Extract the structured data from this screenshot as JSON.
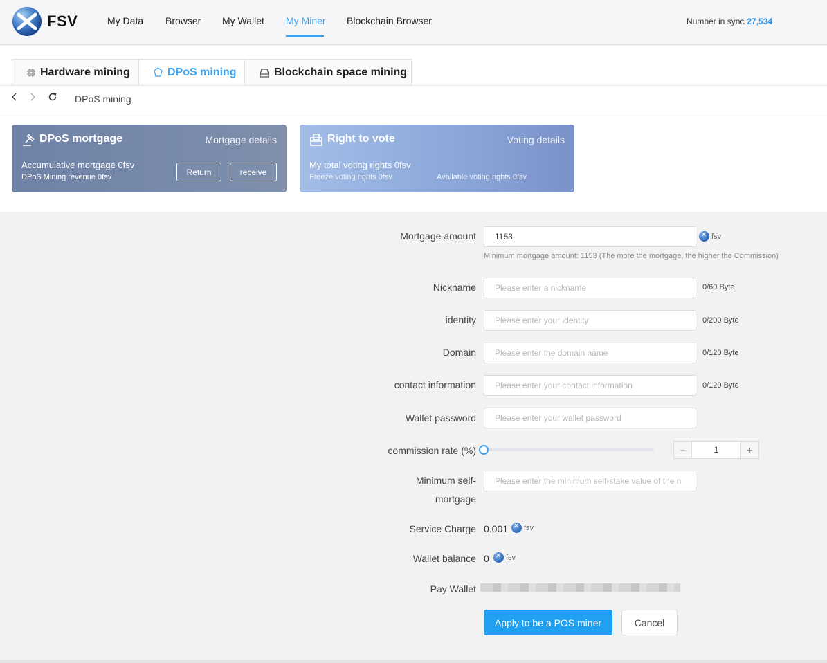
{
  "header": {
    "brand": "FSV",
    "nav": [
      "My Data",
      "Browser",
      "My Wallet",
      "My Miner",
      "Blockchain Browser"
    ],
    "active_nav": "My Miner",
    "sync_label": "Number in sync",
    "sync_value": "27,534"
  },
  "tabs": [
    "Hardware mining",
    "DPoS mining",
    "Blockchain space mining"
  ],
  "active_tab": "DPoS mining",
  "breadcrumb": {
    "label": "DPoS mining"
  },
  "cards": {
    "mortgage": {
      "title": "DPoS mortgage",
      "link": "Mortgage details",
      "line1": "Accumulative mortgage 0fsv",
      "line2": "DPoS Mining revenue 0fsv",
      "return_label": "Return",
      "receive_label": "receive"
    },
    "vote": {
      "title": "Right to vote",
      "link": "Voting details",
      "line1": "My total voting rights 0fsv",
      "freeze": "Freeze voting rights 0fsv",
      "available": "Available voting rights 0fsv"
    }
  },
  "form": {
    "mortgage_amount": {
      "label": "Mortgage amount",
      "value": "1153",
      "unit": "fsv",
      "hint": "Minimum mortgage amount: 1153 (The more the mortgage, the higher the Commission)"
    },
    "nickname": {
      "label": "Nickname",
      "placeholder": "Please enter a nickname",
      "counter": "0/60 Byte"
    },
    "identity": {
      "label": "identity",
      "placeholder": "Please enter your identity",
      "counter": "0/200 Byte"
    },
    "domain": {
      "label": "Domain",
      "placeholder": "Please enter the domain name",
      "counter": "0/120 Byte"
    },
    "contact": {
      "label": "contact information",
      "placeholder": "Please enter your contact information",
      "counter": "0/120 Byte"
    },
    "password": {
      "label": "Wallet password",
      "placeholder": "Please enter your wallet password"
    },
    "commission": {
      "label": "commission rate (%)",
      "slider_value": 0,
      "stepper_value": "1",
      "minus": "−",
      "plus": "+"
    },
    "min_self": {
      "label_line1": "Minimum self-",
      "label_line2": "mortgage",
      "placeholder": "Please enter the minimum self-stake value of the n"
    },
    "service_charge": {
      "label": "Service Charge",
      "value": "0.001",
      "unit": "fsv"
    },
    "wallet_balance": {
      "label": "Wallet balance",
      "value": "0",
      "unit": "fsv"
    },
    "pay_wallet": {
      "label": "Pay Wallet"
    },
    "apply_label": "Apply to be a POS miner",
    "cancel_label": "Cancel"
  },
  "colors": {
    "accent": "#3ea3ef",
    "primary_button": "#20a0f0",
    "card1": "#7485a8",
    "card2": "#94afe0"
  }
}
